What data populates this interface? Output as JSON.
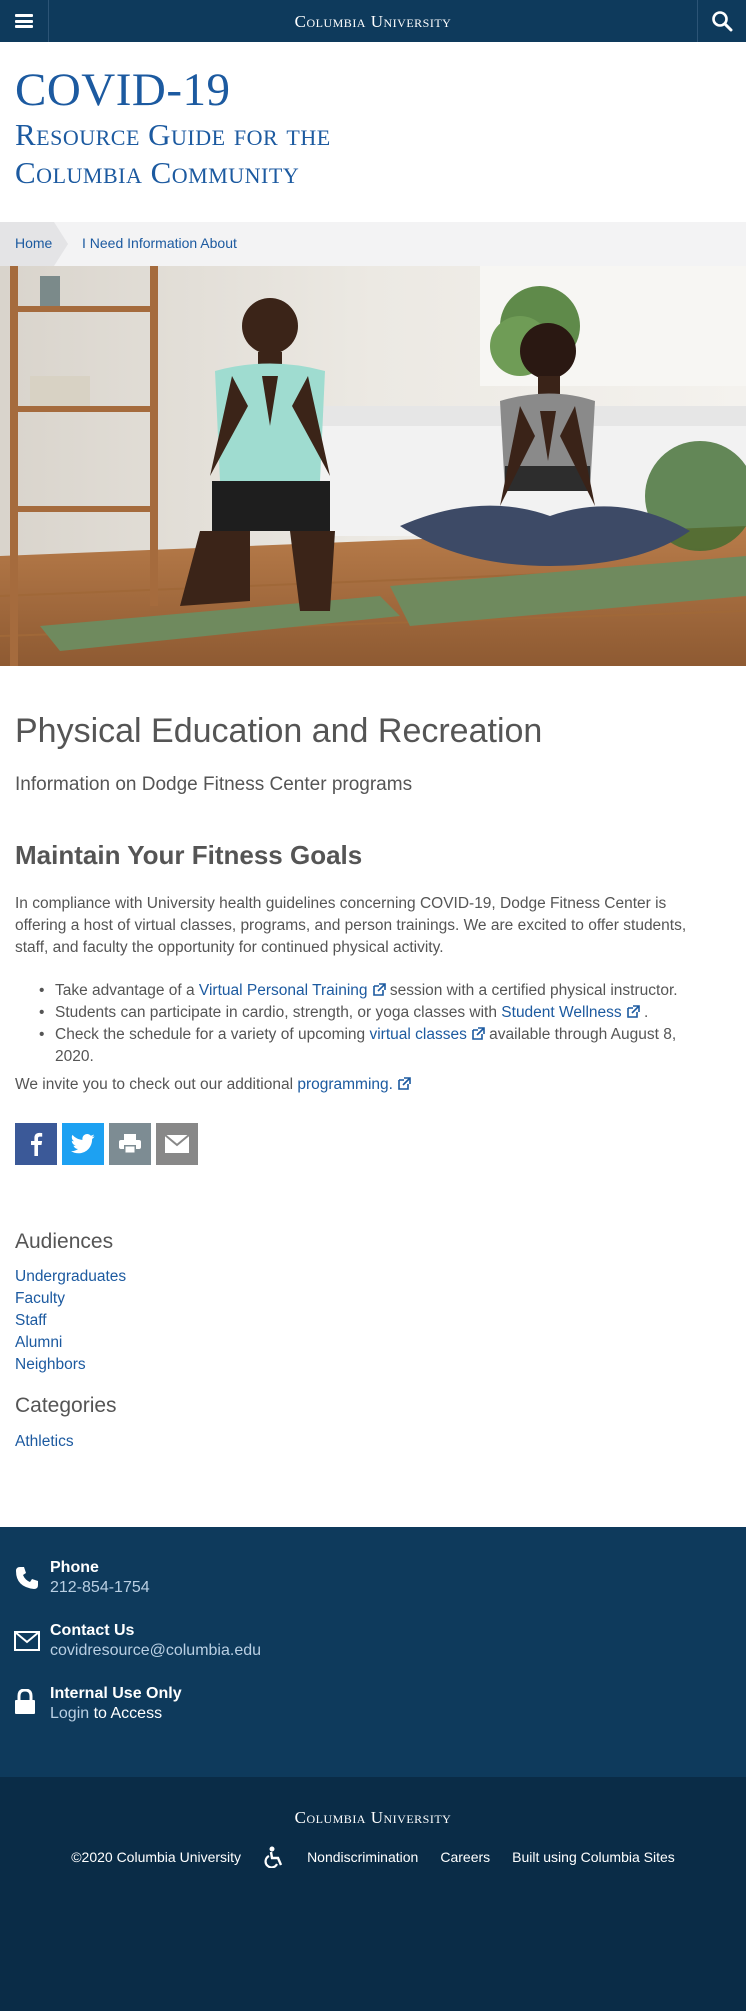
{
  "header": {
    "menu_icon": "hamburger-menu-icon",
    "title": "Columbia University",
    "search_icon": "search-icon"
  },
  "site": {
    "title_line1": "COVID-19",
    "title_line2": "Resource Guide for the",
    "title_line3": "Columbia Community"
  },
  "breadcrumb": {
    "home": "Home",
    "current": "I Need Information About"
  },
  "hero": {
    "alt": "man-and-woman-meditating-on-yoga-mats"
  },
  "main": {
    "heading": "Physical Education and Recreation",
    "subheading": "Information on Dodge Fitness Center programs",
    "section_heading": "Maintain Your Fitness Goals",
    "paragraph": "In compliance with University health guidelines concerning COVID-19, Dodge Fitness Center is offering a host of virtual classes, programs, and person trainings. We are excited to offer students, staff, and faculty the opportunity for continued physical activity.",
    "bullets": [
      {
        "before": "Take advantage of a ",
        "link": "Virtual Personal Training",
        "after": " session with a certified physical instructor."
      },
      {
        "before": "Students can participate in cardio, strength, or yoga classes with ",
        "link": "Student Wellness",
        "after": " ."
      },
      {
        "before": "Check the schedule for a variety of upcoming ",
        "link": "virtual classes",
        "after": " available through August 8, 2020."
      }
    ],
    "invite_before": "We invite you to check out our additional ",
    "invite_link": "programming.",
    "share": {
      "facebook": "facebook-icon",
      "twitter": "twitter-icon",
      "print": "print-icon",
      "email": "email-icon"
    }
  },
  "audiences": {
    "title": "Audiences",
    "items": [
      "Undergraduates",
      "Faculty",
      "Staff",
      "Alumni",
      "Neighbors"
    ]
  },
  "categories": {
    "title": "Categories",
    "items": [
      "Athletics"
    ]
  },
  "footer": {
    "phone_label": "Phone",
    "phone_value": "212-854-1754",
    "contact_label": "Contact Us",
    "contact_value": "covidresource@columbia.edu",
    "internal_label": "Internal Use Only",
    "login_link": "Login",
    "login_after": " to Access",
    "bottom_title": "Columbia University",
    "copyright": "©2020 Columbia University",
    "nondiscrimination": "Nondiscrimination",
    "careers": "Careers",
    "built": "Built using Columbia Sites"
  },
  "colors": {
    "navy": "#0e3a5c",
    "navy_dark": "#0a2c47",
    "link_blue": "#1c5aa0",
    "facebook": "#3b5998",
    "twitter": "#1da1f2"
  }
}
